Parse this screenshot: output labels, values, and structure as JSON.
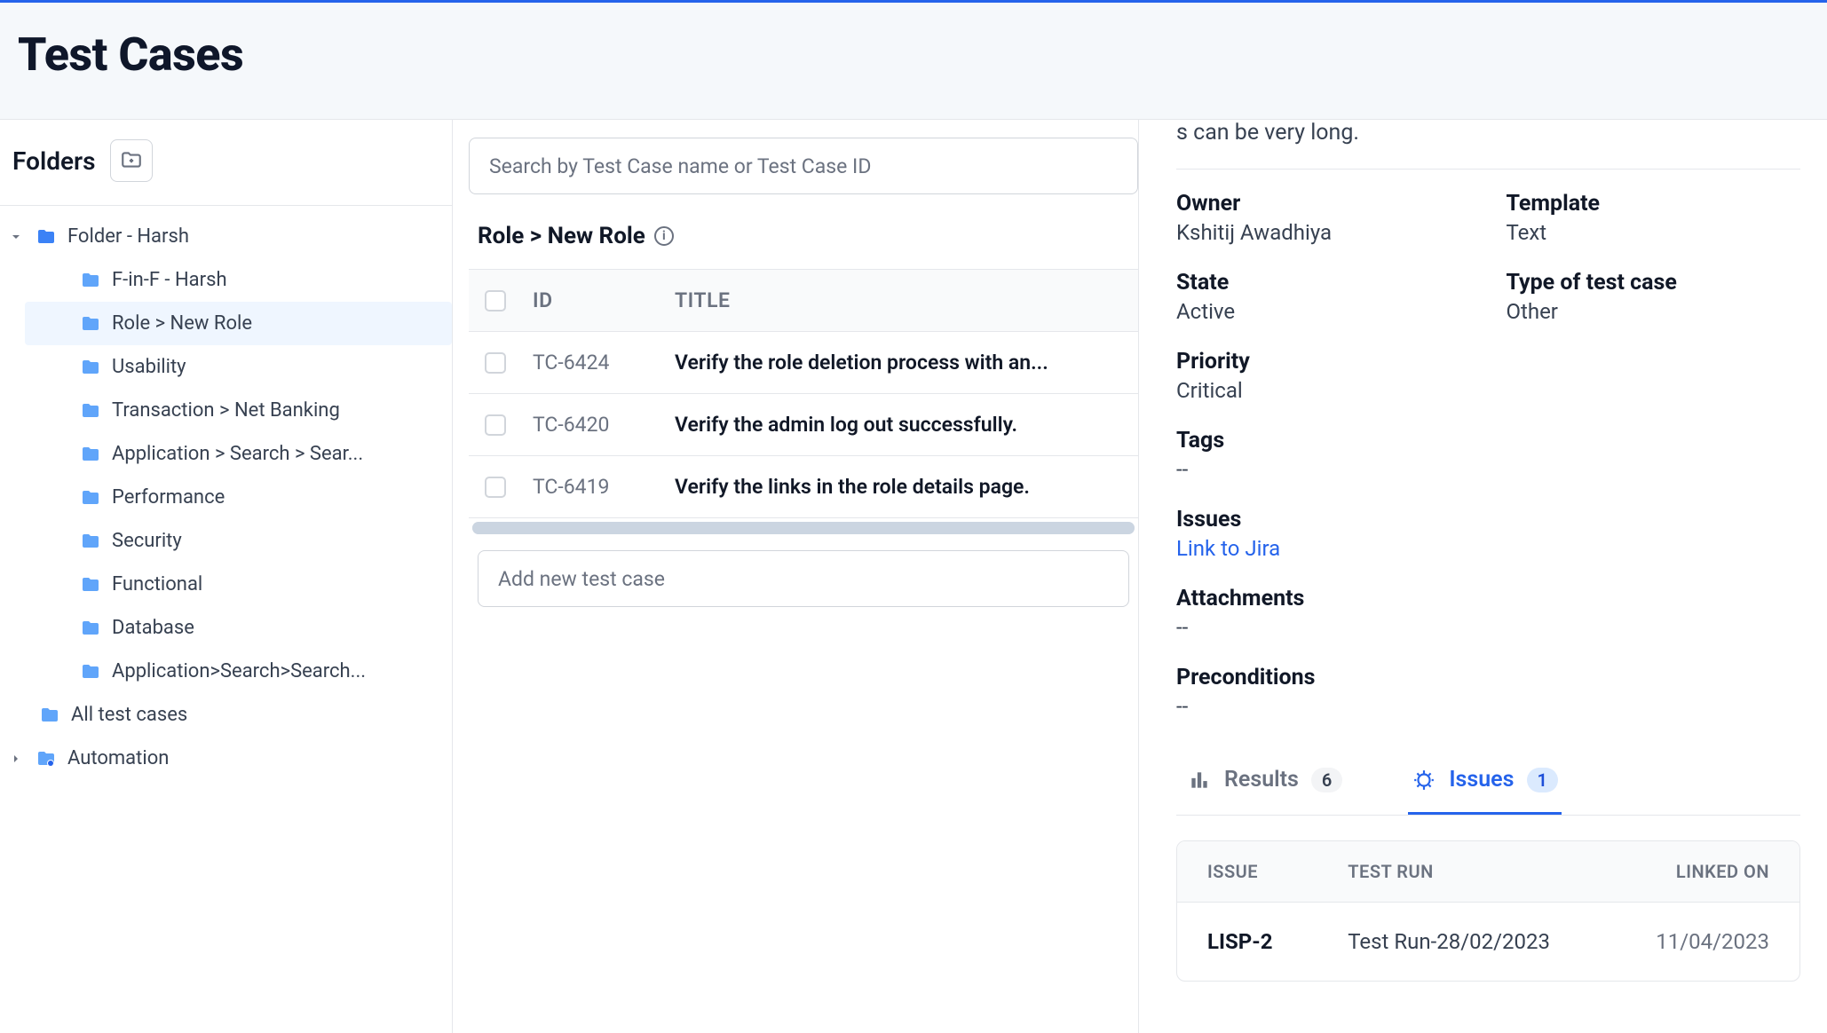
{
  "header": {
    "title": "Test Cases"
  },
  "sidebar": {
    "title": "Folders",
    "root": {
      "label": "Folder - Harsh",
      "expanded": true
    },
    "children": [
      {
        "label": "F-in-F - Harsh"
      },
      {
        "label": "Role > New Role",
        "active": true
      },
      {
        "label": "Usability"
      },
      {
        "label": "Transaction > Net Banking"
      },
      {
        "label": "Application > Search > Sear..."
      },
      {
        "label": "Performance"
      },
      {
        "label": "Security"
      },
      {
        "label": "Functional"
      },
      {
        "label": "Database"
      },
      {
        "label": "Application>Search>Search..."
      }
    ],
    "all_label": "All test cases",
    "automation_label": "Automation"
  },
  "main": {
    "search_placeholder": "Search by Test Case name or Test Case ID",
    "breadcrumb": "Role > New Role",
    "columns": {
      "id": "ID",
      "title": "TITLE"
    },
    "rows": [
      {
        "id": "TC-6424",
        "title": "Verify the role deletion process with an..."
      },
      {
        "id": "TC-6420",
        "title": "Verify the admin log out successfully."
      },
      {
        "id": "TC-6419",
        "title": "Verify the links in the role details page."
      }
    ],
    "add_placeholder": "Add new test case"
  },
  "details": {
    "truncated_line": "s can be very long.",
    "fields": {
      "owner_label": "Owner",
      "owner_value": "Kshitij Awadhiya",
      "template_label": "Template",
      "template_value": "Text",
      "state_label": "State",
      "state_value": "Active",
      "type_label": "Type of test case",
      "type_value": "Other",
      "priority_label": "Priority",
      "priority_value": "Critical",
      "tags_label": "Tags",
      "tags_value": "--",
      "issues_label": "Issues",
      "issues_link": "Link to Jira",
      "attachments_label": "Attachments",
      "attachments_value": "--",
      "preconditions_label": "Preconditions",
      "preconditions_value": "--"
    },
    "tabs": {
      "results_label": "Results",
      "results_count": "6",
      "issues_label": "Issues",
      "issues_count": "1"
    },
    "issues_table": {
      "headers": {
        "issue": "ISSUE",
        "run": "TEST RUN",
        "linked": "LINKED ON"
      },
      "rows": [
        {
          "issue": "LISP-2",
          "run": "Test Run-28/02/2023",
          "linked": "11/04/2023"
        }
      ]
    }
  }
}
